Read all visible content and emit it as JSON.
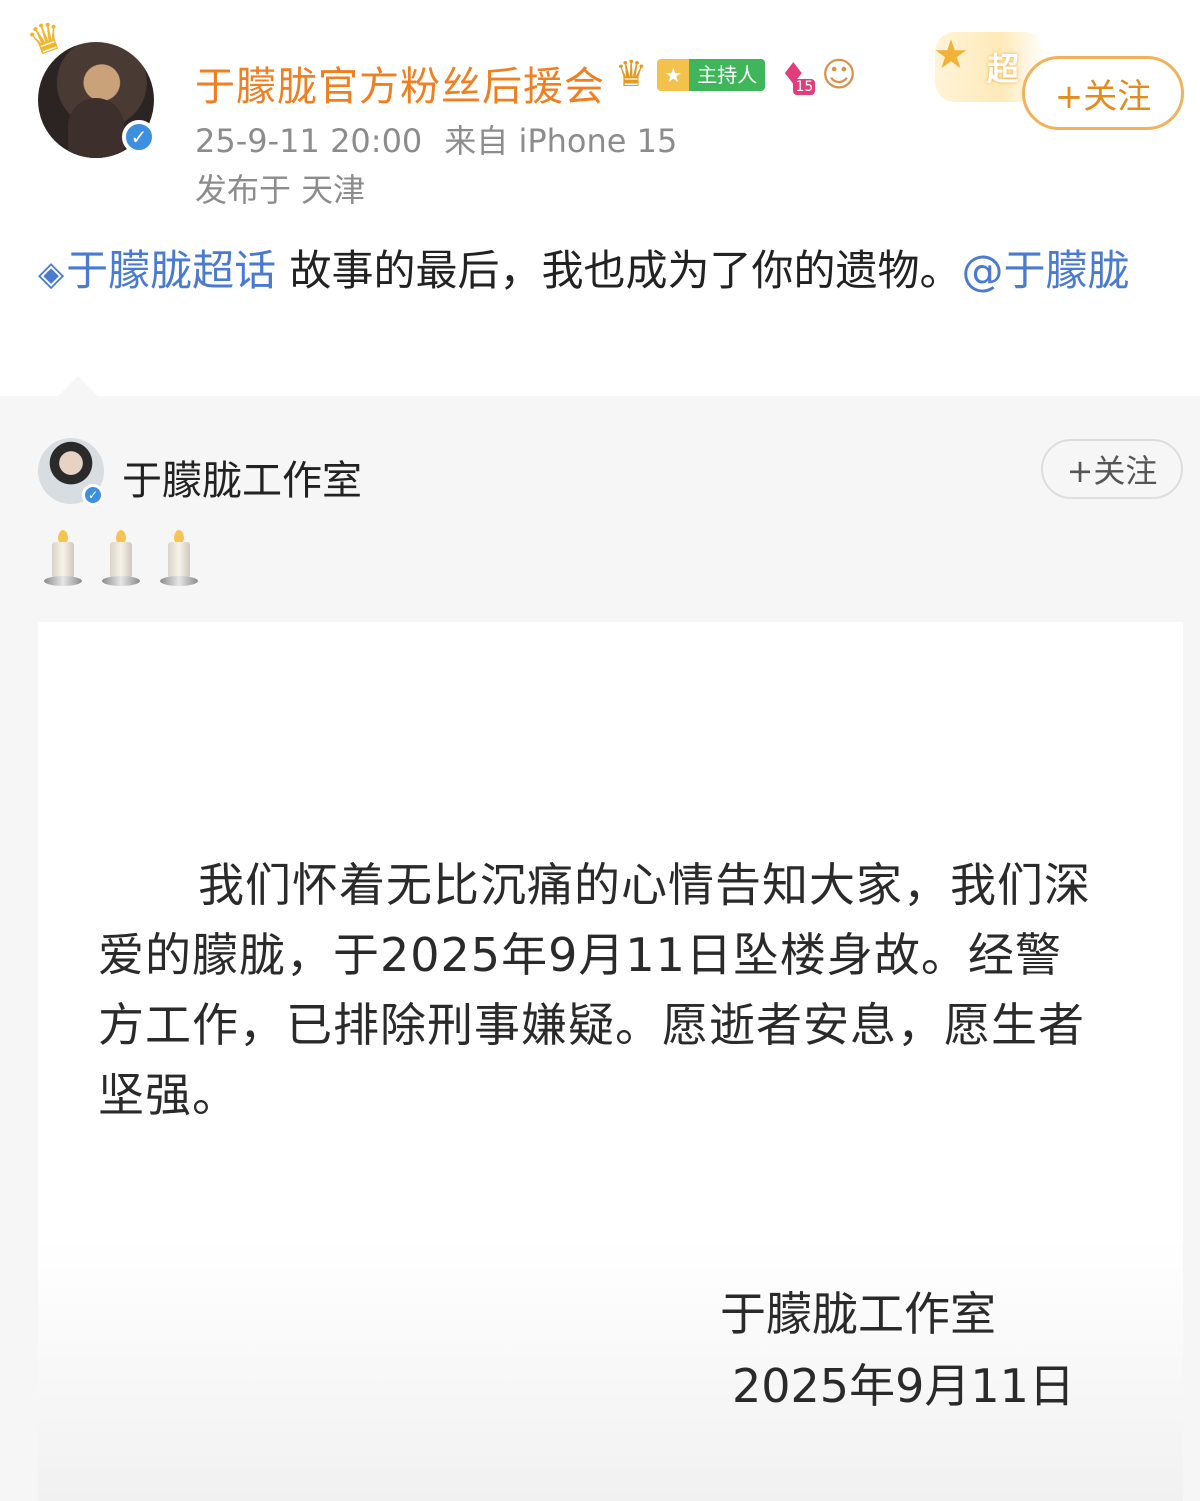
{
  "post": {
    "author_name": "于朦胧官方粉丝后援会",
    "host_badge": "主持人",
    "diamond_level": "15",
    "super_badge": "超",
    "follow_label": "+关注",
    "date": "25-9-11 20:00",
    "source": "来自 iPhone 15",
    "location": "发布于 天津",
    "topic": "于朦胧超话",
    "text": " 故事的最后，我也成为了你的遗物。",
    "mention": "@于朦胧"
  },
  "repost": {
    "author_name": "于朦胧工作室",
    "follow_label": "+关注",
    "emoji": [
      "candle-icon",
      "candle-icon",
      "candle-icon"
    ],
    "notice": {
      "body": "我们怀着无比沉痛的心情告知大家，我们深爱的朦胧，于2025年9月11日坠楼身故。经警方工作，已排除刑事嫌疑。愿逝者安息，愿生者坚强。",
      "signature": "于朦胧工作室",
      "date": "2025年9月11日"
    }
  },
  "colors": {
    "author_orange": "#f07f22",
    "link_blue": "#4a7bd0",
    "verified_blue": "#3d8fe0",
    "host_green": "#3fb65a"
  }
}
